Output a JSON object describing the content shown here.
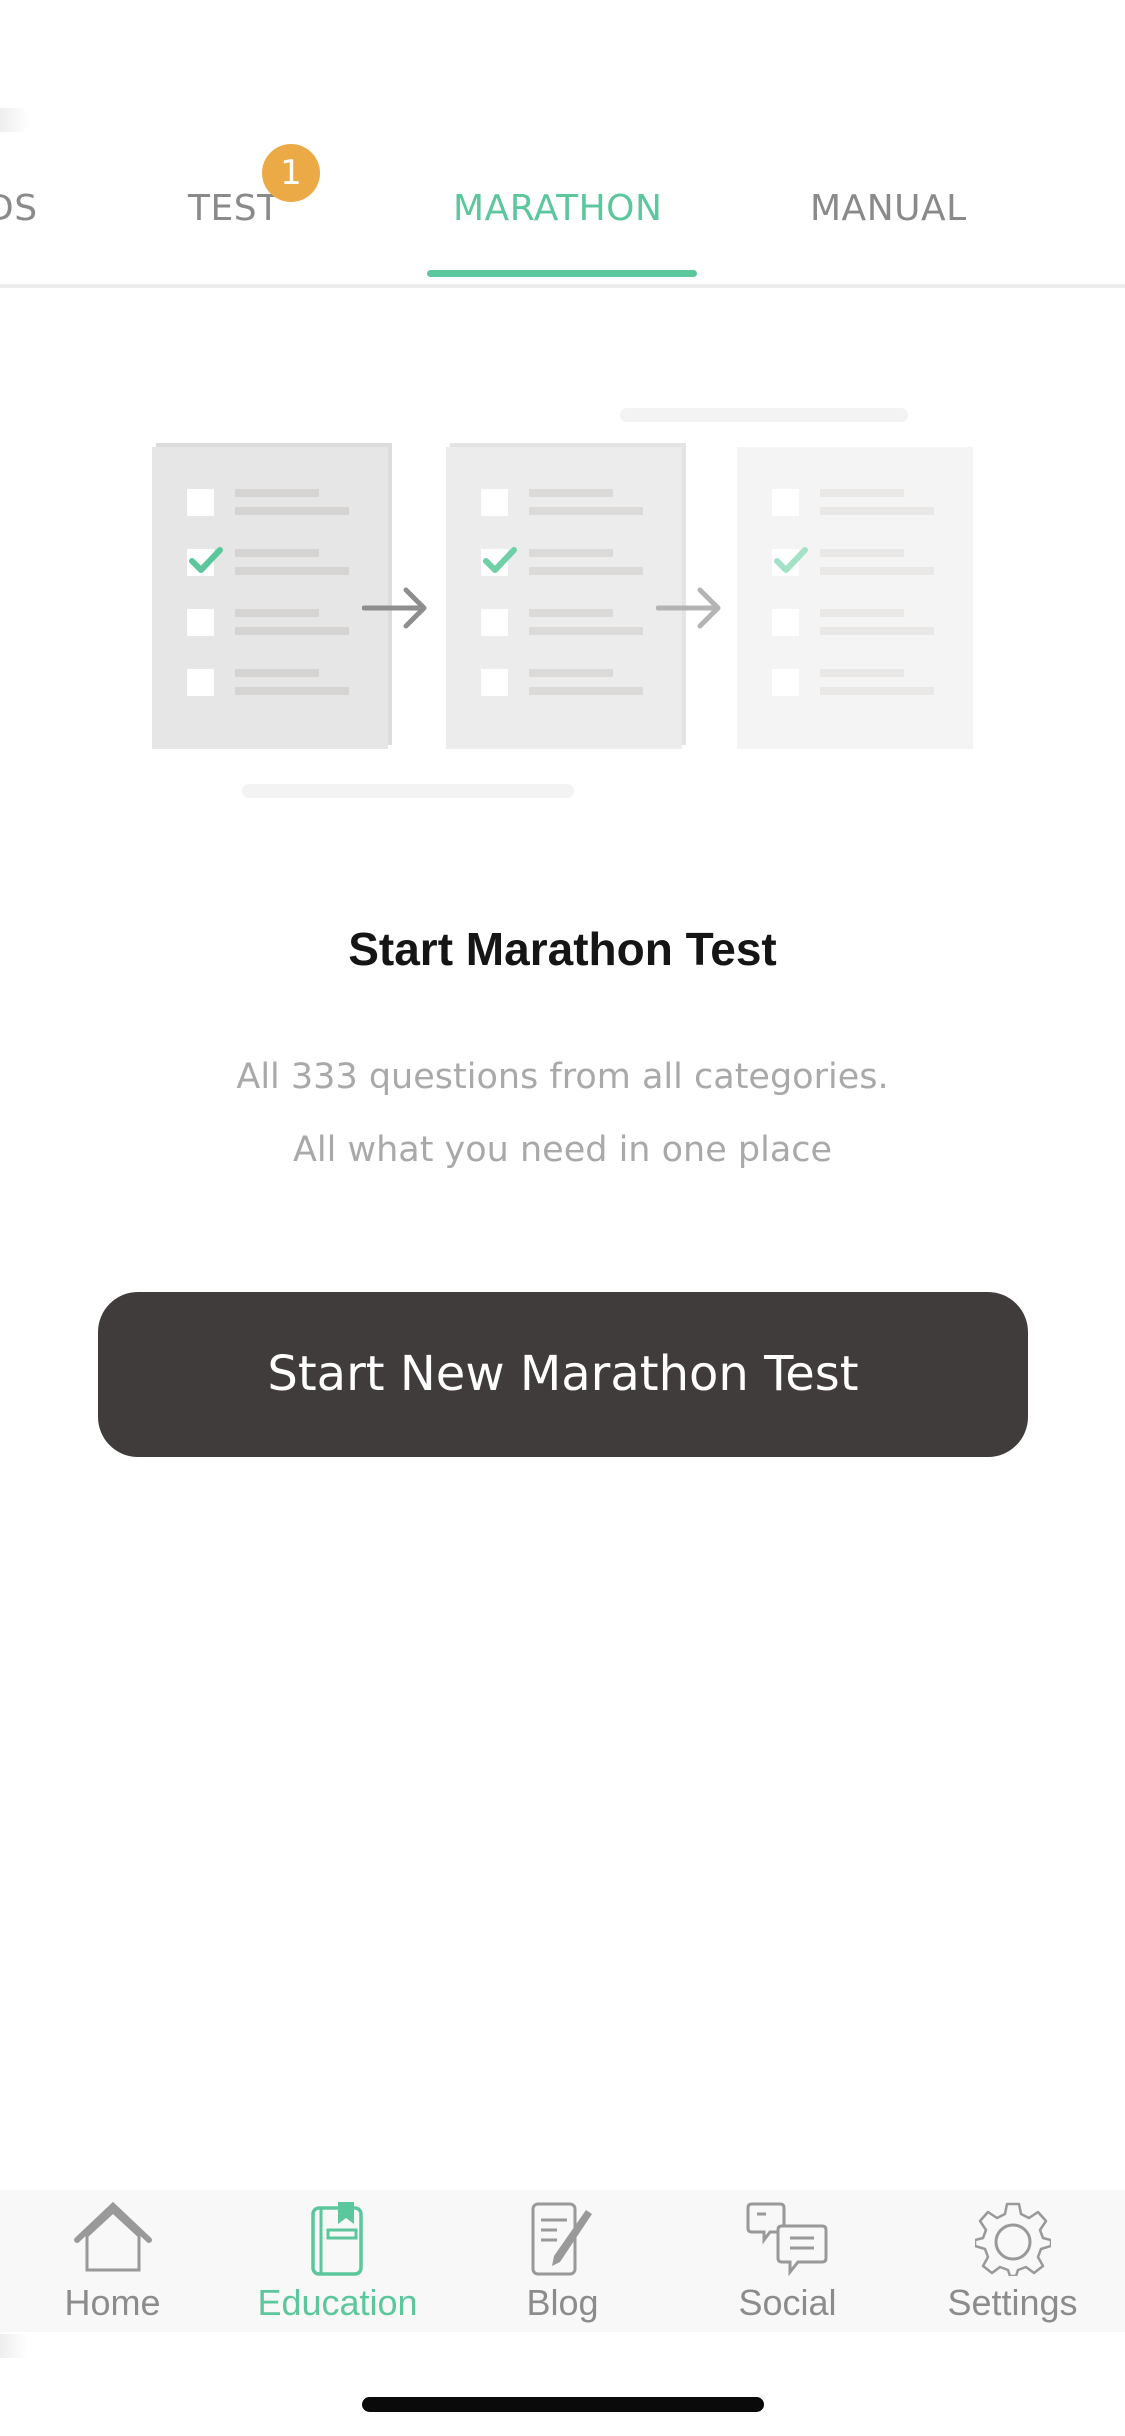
{
  "tabs": {
    "items": [
      {
        "label": "DS",
        "visible_text": "DS",
        "active": false
      },
      {
        "label": "TEST",
        "active": false,
        "badge": "1"
      },
      {
        "label": "MARATHON",
        "active": true
      },
      {
        "label": "MANUAL",
        "active": false
      }
    ]
  },
  "main": {
    "title": "Start Marathon Test",
    "description_line1": "All 333 questions from all categories.",
    "description_line2": "All what you need in one place",
    "start_button_label": "Start New Marathon Test"
  },
  "bottom_nav": {
    "items": [
      {
        "label": "Home",
        "icon": "home-icon",
        "active": false
      },
      {
        "label": "Education",
        "icon": "book-icon",
        "active": true
      },
      {
        "label": "Blog",
        "icon": "edit-note-icon",
        "active": false
      },
      {
        "label": "Social",
        "icon": "chat-bubbles-icon",
        "active": false
      },
      {
        "label": "Settings",
        "icon": "gear-icon",
        "active": false
      }
    ]
  },
  "colors": {
    "accent": "#5cc79c",
    "badge": "#ecaa47",
    "button_bg": "#403c3b",
    "inactive_text": "#8a8a8a"
  }
}
